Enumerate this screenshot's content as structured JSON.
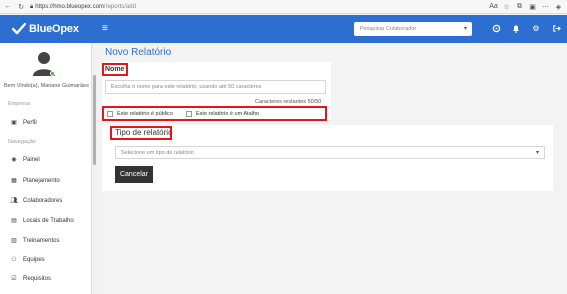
{
  "browser": {
    "url_host": "https://hmo.blueopex.com",
    "url_path": "/reports/add"
  },
  "header": {
    "brand": "BlueOpex",
    "search_placeholder": "Pesquisar Colaborador",
    "icons": [
      "refresh-icon",
      "bell-icon",
      "gear-icon",
      "logout-icon"
    ]
  },
  "sidebar": {
    "welcome": "Bem Vindo(a), Mariane Guimarães",
    "section_empresa": "Empresa",
    "perfil": "Perfil",
    "section_navegacao": "Navegação",
    "items": [
      {
        "label": "Painel",
        "icon": "dashboard-icon"
      },
      {
        "label": "Planejamento",
        "icon": "calendar-icon"
      },
      {
        "label": "Colaboradores",
        "icon": "users-icon"
      },
      {
        "label": "Locais de Trabalho",
        "icon": "building-icon"
      },
      {
        "label": "Treinamentos",
        "icon": "training-icon"
      },
      {
        "label": "Equipes",
        "icon": "team-icon"
      },
      {
        "label": "Requisitos",
        "icon": "checklist-icon"
      }
    ]
  },
  "main": {
    "title": "Novo Relatório",
    "nome_label": "Nome",
    "nome_placeholder": "Escolha o nome para este relatório, usando até 50 caracteres",
    "char_counter": "Caracteres restantes 50/50",
    "check_public": "Este relatório é público",
    "check_shortcut": "Este relatório é um Atalho",
    "tipo_label": "Tipo de relatório",
    "tipo_placeholder": "Selecione um tipo de relatório",
    "cancel": "Cancelar"
  },
  "colors": {
    "accent": "#2c6fd1",
    "highlight": "#e0171c",
    "status_online": "#3ab34a"
  }
}
